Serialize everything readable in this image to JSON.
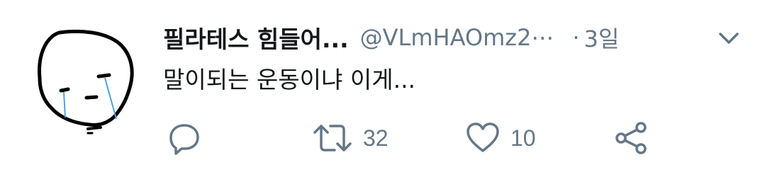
{
  "tweet": {
    "display_name": "필라테스 힘들어...",
    "handle": "@VLmHAOmz2⋯",
    "separator": "·",
    "time": "3일",
    "text": "말이되는 운동이냐 이게...",
    "actions": {
      "reply_icon": "reply-icon",
      "retweet_icon": "retweet-icon",
      "retweet_count": "32",
      "like_icon": "heart-icon",
      "like_count": "10",
      "share_icon": "share-icon"
    },
    "menu_icon": "chevron-down-icon"
  },
  "colors": {
    "text": "#14171a",
    "secondary": "#657786",
    "background": "#ffffff"
  }
}
